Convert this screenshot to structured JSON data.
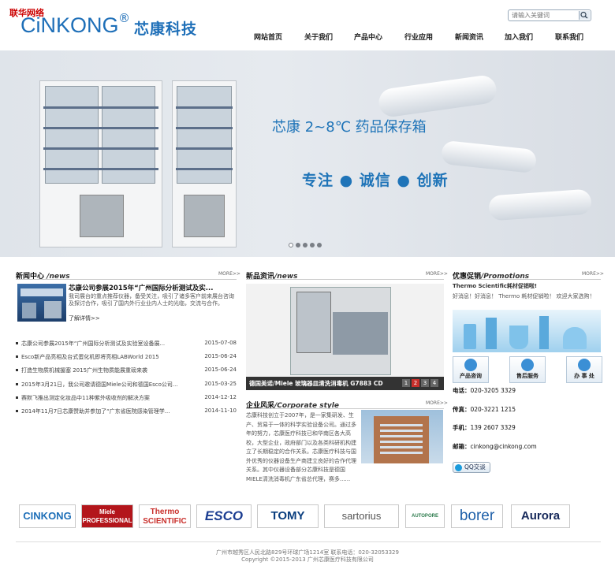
{
  "top_tag": "联华网络",
  "logo": {
    "en": "CiNKONG",
    "reg": "®",
    "cn": "芯康科技"
  },
  "search": {
    "placeholder": "请输入关键词"
  },
  "nav": [
    "网站首页",
    "关于我们",
    "产品中心",
    "行业应用",
    "新闻资讯",
    "加入我们",
    "联系我们"
  ],
  "banner": {
    "title": "芯康 2~8℃ 药品保存箱",
    "slogan": "专注 ● 诚信 ● 创新",
    "slides": 5,
    "active_slide": 1
  },
  "news_center": {
    "title": "新闻中心",
    "title_en": "/news",
    "more": "MORE>>",
    "featured_title": "芯康公司参展2015年“广州国际分析测试及实...",
    "featured_text": "我司展台的重点推荐仪器，备受关注，吸引了诸多客户前来展台咨询及探讨合作，吸引了国内外行业业内人士的光临，交流与合作。",
    "featured_link": "了解详情>>",
    "items": [
      {
        "title": "芯康公司参展2015年“广州国际分析测试及实验室设备展...",
        "date": "2015-07-08"
      },
      {
        "title": "Esco新产品亮相及台式蛋化机即将亮相LABWorld 2015",
        "date": "2015-06-24"
      },
      {
        "title": "打造生物质机械援塞 2015广州生物质能展重磅来袭",
        "date": "2015-06-24"
      },
      {
        "title": "2015年3月21日，我公司邀请德国Miele公司和德国Esco公司...",
        "date": "2015-03-25"
      },
      {
        "title": "赛默飞推出测定化妆品中11种紫外吸收剂的解决方案",
        "date": "2014-12-12"
      },
      {
        "title": "2014年11月7日芯康赞助并参加了“广东省医院感染管理学...",
        "date": "2014-11-10"
      }
    ]
  },
  "new_products": {
    "title": "新品资讯",
    "title_en": "/news",
    "more": "MORE>>",
    "caption": "德国美诺/Miele 玻璃器皿清洗消毒机 G7883 CD",
    "pages": [
      "1",
      "2",
      "3",
      "4"
    ],
    "active_page": "2"
  },
  "corporate": {
    "title": "企业风采",
    "title_en": "/Corporate style",
    "more": "MORE>>",
    "text": "芯康科技创立于2007年，是一家集研发、生产、贸易于一体的科学实验设备公司。通过多年的努力，芯康医疗科技已和华南区各大高校，大型企业，政府部门以及各类科研机构建立了长期稳定的合作关系。芯康医疗科技与国外优秀的仪器设备生产商建立良好的合作代理关系。其中仪器设备部分芯康科技是德国MIELE清洗消毒机广东省总代理，赛多......"
  },
  "promotions": {
    "title": "优惠促销",
    "title_en": "/Promotions",
    "more": "MORE>>",
    "headline": "Thermo Scientific耗材促销啦!",
    "text": "好消息！好消息！ Thermo 耗材促销啦！ 欢迎大家选购！"
  },
  "services": [
    {
      "label": "产品咨询",
      "icon": "consult-icon"
    },
    {
      "label": "售后服务",
      "icon": "service-icon"
    },
    {
      "label": "办 事 处",
      "icon": "office-icon"
    }
  ],
  "contact": [
    {
      "label": "电话：",
      "value": "020-3205 3329"
    },
    {
      "label": "传真：",
      "value": "020-3221 1215"
    },
    {
      "label": "手机：",
      "value": "139 2607 3329"
    },
    {
      "label": "邮箱：",
      "value": "cinkong@cinkong.com"
    }
  ],
  "qq_label": "QQ交谈",
  "brands": [
    "CINKONG",
    "Miele PROFESSIONAL",
    "Thermo SCIENTIFIC",
    "ESCO",
    "TOMY",
    "sartorius",
    "AUTOPORE",
    "borer",
    "Aurora"
  ],
  "footer": {
    "line1": "广州市越秀区人民北路829号环球广场1214室 联系电话：020-32053329",
    "line2": "Copyright ©2015-2013 广州芯康医疗科技有限公司"
  },
  "colors": {
    "brand_blue": "#1e6fb8",
    "tag_red": "#cc0000"
  }
}
